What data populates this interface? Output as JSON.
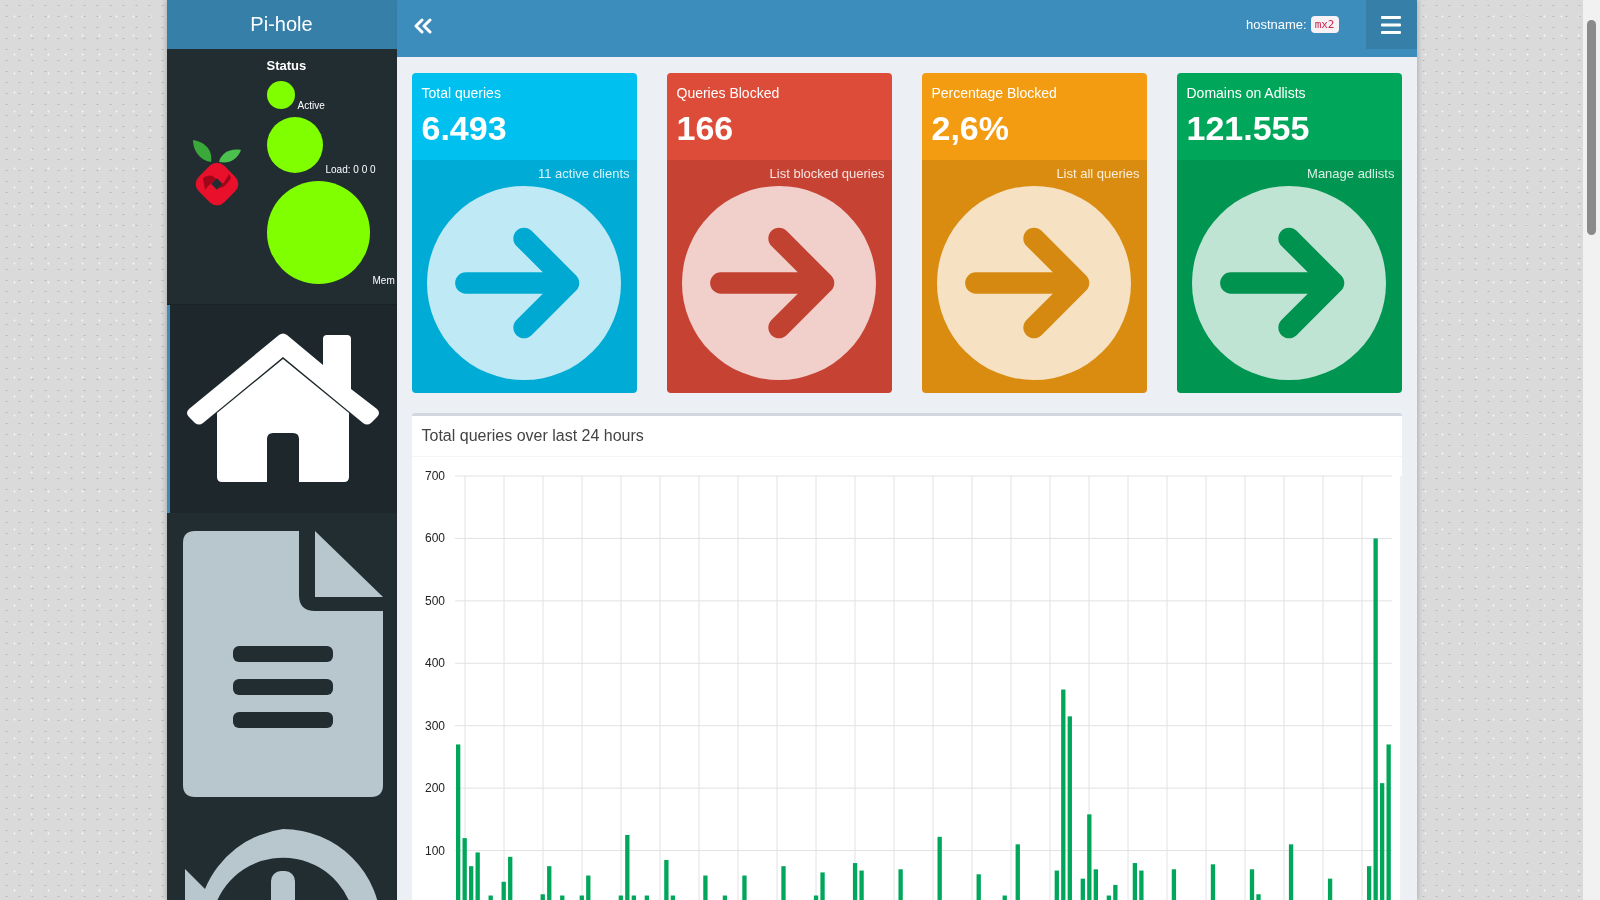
{
  "sidebar": {
    "title": "Pi-hole",
    "status": {
      "heading": "Status",
      "items": [
        {
          "label": "Active"
        },
        {
          "label": "Load:  0  0  0"
        },
        {
          "label": "Mem"
        }
      ]
    },
    "menu": [
      {
        "kind": "home",
        "selected": true
      },
      {
        "kind": "document",
        "selected": false
      },
      {
        "kind": "history",
        "selected": false
      }
    ]
  },
  "header": {
    "hostname_label": "hostname:",
    "hostname": "mx2"
  },
  "stats": [
    {
      "title": "Total queries",
      "value": "6.493",
      "link": "11 active clients",
      "color": "#00c0ef"
    },
    {
      "title": "Queries Blocked",
      "value": "166",
      "link": "List blocked queries",
      "color": "#dd4b39"
    },
    {
      "title": "Percentage Blocked",
      "value": "2,6%",
      "link": "List all queries",
      "color": "#f39c12"
    },
    {
      "title": "Domains on Adlists",
      "value": "121.555",
      "link": "Manage adlists",
      "color": "#00a65a"
    }
  ],
  "chart": {
    "title": "Total queries over last 24 hours",
    "chart_data": {
      "type": "bar",
      "grid": true,
      "ylim": [
        0,
        700
      ],
      "yticks": [
        100,
        200,
        300,
        400,
        500,
        600,
        700
      ],
      "series": [
        {
          "color": "#00a65a",
          "values": [
            270,
            120,
            75,
            97,
            0,
            28,
            0,
            50,
            90,
            0,
            0,
            0,
            0,
            30,
            75,
            0,
            28,
            0,
            0,
            28,
            60,
            0,
            0,
            0,
            0,
            28,
            125,
            28,
            0,
            28,
            0,
            0,
            85,
            28,
            0,
            0,
            0,
            0,
            60,
            0,
            0,
            28,
            0,
            0,
            60,
            0,
            0,
            0,
            0,
            0,
            75,
            0,
            0,
            0,
            0,
            28,
            65,
            0,
            0,
            0,
            0,
            80,
            68,
            0,
            0,
            0,
            0,
            0,
            70,
            0,
            0,
            0,
            0,
            0,
            122,
            0,
            0,
            0,
            0,
            0,
            62,
            0,
            0,
            0,
            28,
            0,
            110,
            0,
            0,
            0,
            0,
            0,
            68,
            358,
            315,
            0,
            55,
            158,
            70,
            0,
            28,
            45,
            0,
            0,
            80,
            68,
            0,
            0,
            0,
            0,
            70,
            0,
            0,
            0,
            0,
            0,
            78,
            0,
            0,
            0,
            0,
            0,
            70,
            30,
            0,
            0,
            0,
            0,
            110,
            0,
            0,
            0,
            0,
            0,
            55,
            0,
            0,
            0,
            0,
            0,
            75,
            600,
            208,
            270
          ]
        }
      ]
    }
  }
}
